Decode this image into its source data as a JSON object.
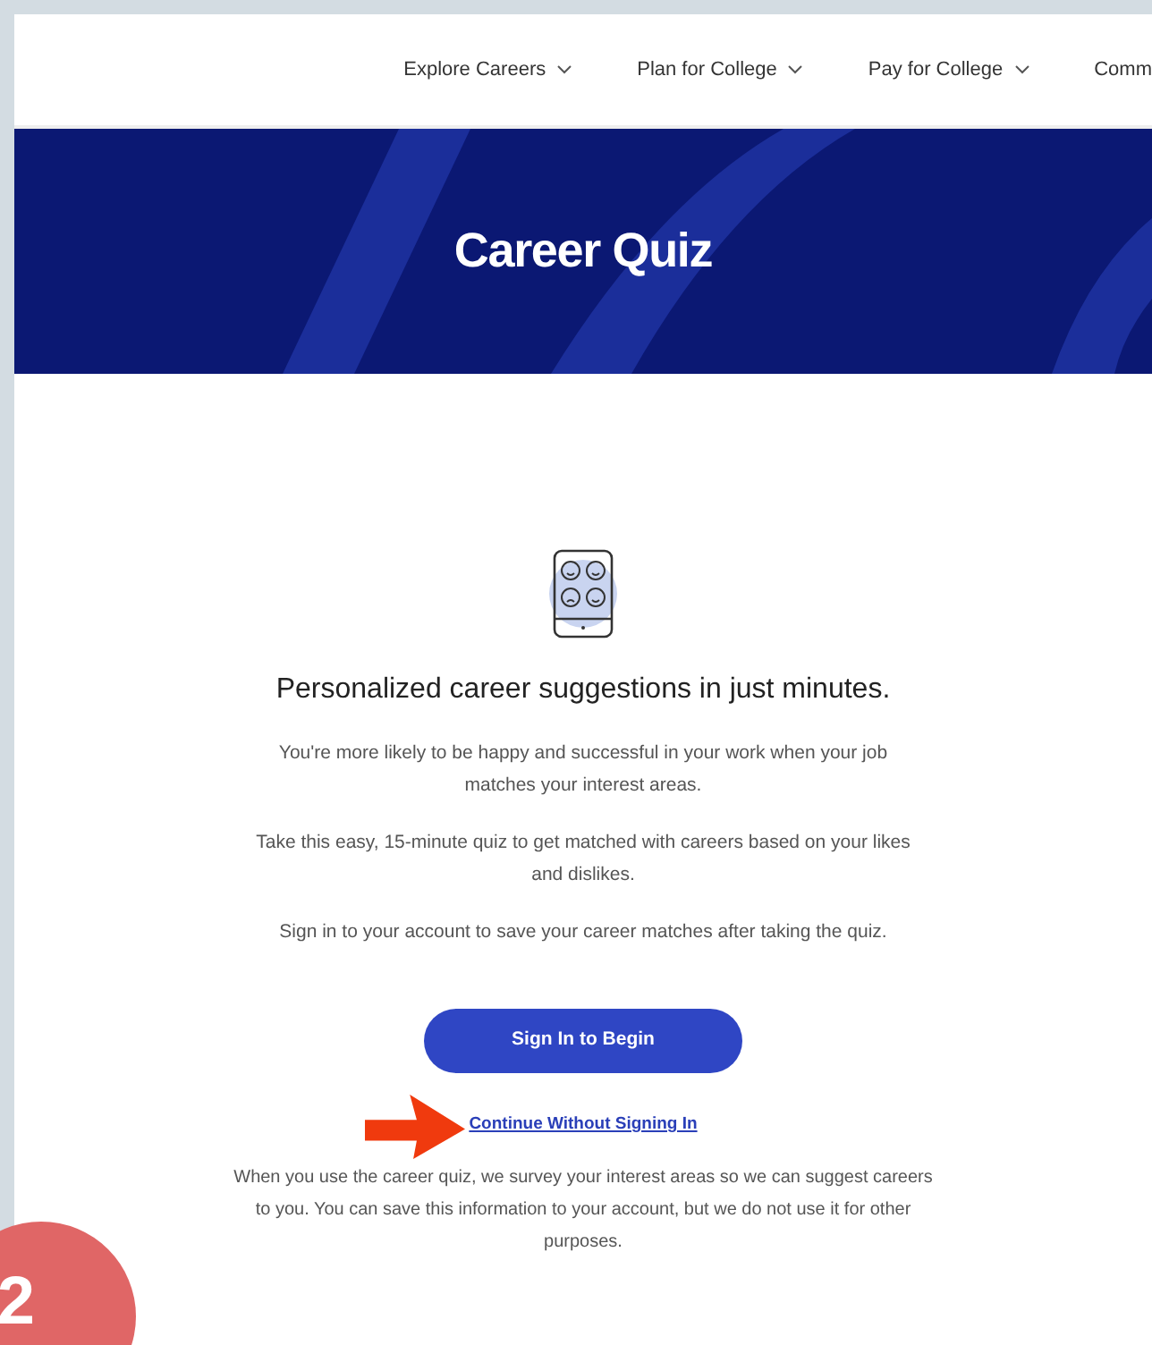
{
  "nav": {
    "items": [
      {
        "label": "Explore Careers",
        "kind": "menu"
      },
      {
        "label": "Plan for College",
        "kind": "menu"
      },
      {
        "label": "Pay for College",
        "kind": "menu"
      },
      {
        "label": "Comm",
        "kind": "cut"
      }
    ]
  },
  "banner": {
    "title": "Career Quiz"
  },
  "content": {
    "heading": "Personalized career suggestions in just minutes.",
    "paragraphs": [
      "You're more likely to be happy and successful in your work when your job matches your interest areas.",
      "Take this easy, 15-minute quiz to get matched with careers based on your likes and dislikes.",
      "Sign in to your account to save your career matches after taking the quiz."
    ],
    "primary_button": "Sign In to Begin",
    "link": "Continue Without Signing In",
    "note": "When you use the career quiz, we survey your interest areas so we can suggest careers to you. You can save this information to your account, but we do not use it for other purposes."
  },
  "step_badge": "2"
}
